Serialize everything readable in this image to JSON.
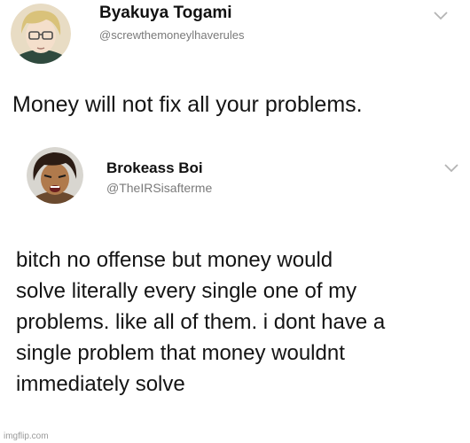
{
  "tweets": [
    {
      "display_name": "Byakuya Togami",
      "handle": "@screwthemoneylhaverules",
      "avatar_icon": "avatar-blond-glasses",
      "menu_icon": "chevron-down-icon",
      "text_lines": [
        "Money will not fix all your problems."
      ]
    },
    {
      "display_name": "Brokeass Boi",
      "handle": "@TheIRSisafterme",
      "avatar_icon": "avatar-dark-hair",
      "menu_icon": "chevron-down-icon",
      "text_lines": [
        "bitch no offense but money would",
        "solve literally every single one of my",
        "problems. like all of them. i dont have a",
        "single problem that money wouldnt",
        "immediately solve"
      ]
    }
  ],
  "watermark": "imgflip.com",
  "colors": {
    "text": "#141414",
    "handle": "#7a7a7a",
    "chevron": "#b4b4b4"
  }
}
